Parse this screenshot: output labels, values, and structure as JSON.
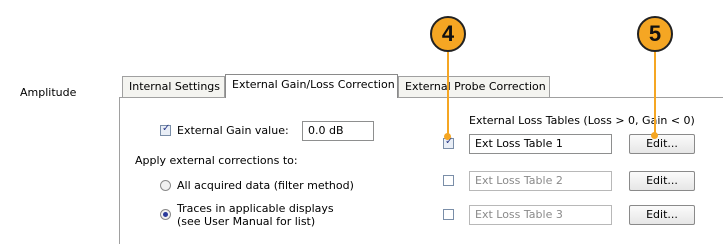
{
  "section_label": "Amplitude",
  "tabs": [
    {
      "label": "Internal Settings"
    },
    {
      "label": "External Gain/Loss Correction"
    },
    {
      "label": "External Probe Correction"
    }
  ],
  "gain": {
    "checkbox_label": "External Gain value:",
    "value": "0.0 dB",
    "checked": true
  },
  "apply_label": "Apply external corrections to:",
  "radios": [
    {
      "label": "All acquired data (filter method)",
      "selected": false
    },
    {
      "label_line1": "Traces in applicable displays",
      "label_line2": "(see User Manual for list)",
      "selected": true
    }
  ],
  "loss_tables": {
    "header": "External Loss Tables (Loss > 0, Gain < 0)",
    "rows": [
      {
        "name": "Ext Loss Table 1",
        "checked": true,
        "edit_label": "Edit..."
      },
      {
        "name": "Ext Loss Table 2",
        "checked": false,
        "edit_label": "Edit..."
      },
      {
        "name": "Ext Loss Table 3",
        "checked": false,
        "edit_label": "Edit..."
      }
    ]
  },
  "callouts": [
    {
      "number": "4"
    },
    {
      "number": "5"
    }
  ],
  "colors": {
    "callout": "#f5a623"
  }
}
